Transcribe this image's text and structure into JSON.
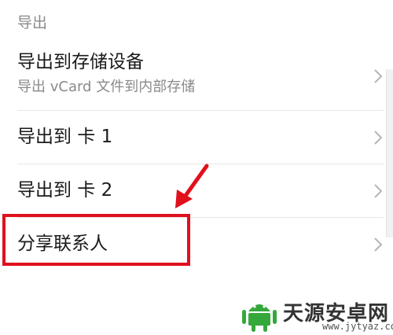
{
  "section": {
    "header": "导出"
  },
  "items": [
    {
      "title": "导出到存储设备",
      "subtitle": "导出 vCard 文件到内部存储"
    },
    {
      "title": "导出到 卡 1"
    },
    {
      "title": "导出到 卡 2"
    },
    {
      "title": "分享联系人"
    }
  ],
  "colors": {
    "highlight": "#e0101c",
    "accent_watermark": "#35a83c"
  },
  "watermark": {
    "title": "天源安卓网",
    "url": "www.jytyaz.com"
  }
}
